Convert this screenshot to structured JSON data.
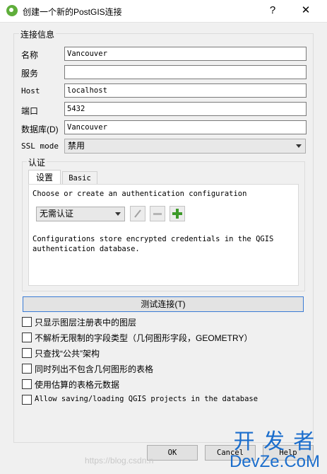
{
  "window": {
    "title": "创建一个新的PostGIS连接",
    "help_label": "?",
    "close_label": "✕"
  },
  "connection": {
    "group_title": "连接信息",
    "name_label": "名称",
    "name_value": "Vancouver",
    "service_label": "服务",
    "service_value": "",
    "host_label": "Host",
    "host_value": "localhost",
    "port_label": "端口",
    "port_value": "5432",
    "db_label": "数据库(D)",
    "db_value": "Vancouver",
    "ssl_label": "SSL mode",
    "ssl_value": "禁用"
  },
  "auth": {
    "group_title": "认证",
    "tabs": [
      "设置",
      "Basic"
    ],
    "choose_text": "Choose or create an authentication configuration",
    "config_value": "无需认证",
    "info_text": "Configurations store encrypted credentials in the QGIS authentication database."
  },
  "test_button": "测试连接(T)",
  "options": [
    {
      "label": "只显示图层注册表中的图层"
    },
    {
      "label": "不解析无限制的字段类型（几何图形字段，GEOMETRY）"
    },
    {
      "label": "只查找“公共”架构"
    },
    {
      "label": "同时列出不包含几何图形的表格"
    },
    {
      "label": "使用估算的表格元数据"
    },
    {
      "label": "Allow saving/loading QGIS projects in the database"
    }
  ],
  "buttons": {
    "ok": "OK",
    "cancel": "Cancel",
    "help": "Help"
  },
  "watermark": {
    "line1": "开 发 者",
    "line2": "DevZe.CoM",
    "url": "https://blog.csdn.n"
  }
}
